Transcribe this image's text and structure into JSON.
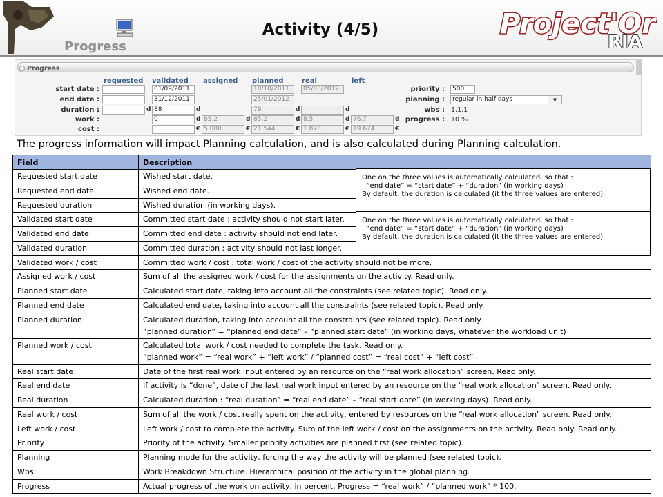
{
  "header": {
    "section": "Progress",
    "title": "Activity (4/5)",
    "brand": "Project'Or",
    "brand_sub": "RIA"
  },
  "form": {
    "panel_title": "Progress",
    "columns": [
      "requested",
      "validated",
      "assigned",
      "planned",
      "real",
      "left"
    ],
    "rows": {
      "start": "start date :",
      "end": "end date :",
      "duration": "duration :",
      "work": "work :",
      "cost": "cost :"
    },
    "values": {
      "validated_start": "01/09/2011",
      "validated_end": "31/12/2011",
      "validated_duration": "88",
      "validated_work": "0",
      "assigned_work": "85,2",
      "assigned_cost": "5 000",
      "planned_start": "10/10/2011",
      "planned_end": "25/01/2012",
      "planned_duration": "79",
      "planned_work": "85,2",
      "planned_cost": "21 544",
      "real_start": "05/03/2012",
      "real_work": "8,5",
      "real_cost": "1 870",
      "left_work": "76,7",
      "left_cost": "19 674"
    },
    "units": {
      "day": "d",
      "euro": "€"
    },
    "right": {
      "priority_label": "priority :",
      "priority_value": "500",
      "planning_label": "planning :",
      "planning_value": "regular in half days",
      "wbs_label": "wbs :",
      "wbs_value": "1.1.1",
      "progress_label": "progress :",
      "progress_value": "10 %"
    }
  },
  "intro": "The progress information will impact Planning calculation, and is also calculated during Planning calculation.",
  "table": {
    "headers": {
      "field": "Field",
      "description": "Description"
    },
    "rows": [
      {
        "field": "Requested start date",
        "lines": [
          "Wished start date."
        ]
      },
      {
        "field": "Requested end date",
        "lines": [
          "Wished end date."
        ]
      },
      {
        "field": "Requested duration",
        "lines": [
          "Wished duration (in working days)."
        ]
      },
      {
        "field": "Validated start date",
        "lines": [
          "Committed start date : activity should not start later."
        ]
      },
      {
        "field": "Validated end date",
        "lines": [
          "Committed end date : activity should not end later."
        ]
      },
      {
        "field": "Validated duration",
        "lines": [
          "Committed duration : activity should not last longer."
        ]
      },
      {
        "field": "Validated work / cost",
        "lines": [
          "Committed work / cost : total work / cost of the activity should not be more."
        ]
      },
      {
        "field": "Assigned work / cost",
        "lines": [
          "Sum of all the assigned work / cost for the assignments on the activity. Read only."
        ]
      },
      {
        "field": "Planned start date",
        "lines": [
          "Calculated start date, taking into account all the constraints (see related topic). Read only."
        ]
      },
      {
        "field": "Planned end date",
        "lines": [
          "Calculated end date, taking into account all the constraints (see related topic). Read only."
        ]
      },
      {
        "field": "Planned duration",
        "lines": [
          "Calculated duration, taking into account all the constraints (see related topic). Read only.",
          "“planned duration” = “planned end date” – “planned start date” (in working days, whatever the workload unit)"
        ]
      },
      {
        "field": "Planned work / cost",
        "lines": [
          "Calculated total work / cost needed to complete the task. Read only.",
          "“planned work” = “real work” + “left work” / “planned cost” = “real cost” + “left cost”"
        ]
      },
      {
        "field": "Real start date",
        "lines": [
          "Date of the first real work input entered by an resource on the “real work allocation” screen. Read only."
        ]
      },
      {
        "field": "Real end date",
        "lines": [
          "If activity is “done”, date of the last real work input entered by an resource on the “real work allocation” screen. Read only."
        ]
      },
      {
        "field": "Real duration",
        "lines": [
          "Calculated duration : “real duration” = “real end date” – “real start date” (in working days). Read only."
        ]
      },
      {
        "field": "Real work / cost",
        "lines": [
          "Sum of all the work / cost really spent on the activity, entered by resources on the “real work allocation” screen. Read only."
        ]
      },
      {
        "field": "Left work / cost",
        "lines": [
          "Left work / cost to complete the activity. Sum of the left work / cost on the assignments on the activity. Read only. Read only."
        ]
      },
      {
        "field": "Priority",
        "lines": [
          "Priority of the activity. Smaller priority activities are planned first (see related topic)."
        ]
      },
      {
        "field": "Planning",
        "lines": [
          "Planning mode for the activity, forcing the way the activity will be planned (see related topic)."
        ]
      },
      {
        "field": "Wbs",
        "lines": [
          "Work Breakdown Structure. Hierarchical position of the activity in the global planning."
        ]
      },
      {
        "field": "Progress",
        "lines": [
          "Actual progress of the work on activity, in percent. Progress = “real work” / “planned work” * 100."
        ]
      }
    ]
  },
  "notes": [
    "One on the three values is automatically calculated, so that :\n  “end date” = “start date” + “duration” (in working days)\nBy default, the duration is calculated (it the three values are entered)",
    "One on the three values is automatically calculated, so that :\n  “end date” = “start date” + “duration” (in working days)\nBy default, the duration is calculated (it the three values are entered)"
  ],
  "colors": {
    "table_header_bg": "#9fb4df",
    "column_header_text": "#3a5d8f",
    "brand_text": "#9c1f1f"
  },
  "icons": [
    "project-logo",
    "computer-monitor-icon",
    "select-dropdown-arrow-icon",
    "collapse-toggle-icon"
  ]
}
